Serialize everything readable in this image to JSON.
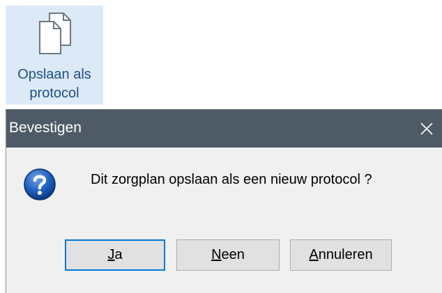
{
  "ribbon": {
    "button": {
      "label_line1": "Opslaan als",
      "label_line2": "protocol",
      "icon": "copy-documents-icon"
    }
  },
  "dialog": {
    "title": "Bevestigen",
    "close_icon": "close-icon",
    "message_icon": "question-icon",
    "message": "Dit zorgplan opslaan als een nieuw protocol ?",
    "buttons": {
      "yes": {
        "accelerator": "J",
        "rest": "a"
      },
      "no": {
        "accelerator": "N",
        "rest": "een"
      },
      "cancel": {
        "accelerator": "A",
        "rest": "nnuleren"
      }
    },
    "colors": {
      "titlebar": "#4e5b66",
      "default_button_border": "#0078d7",
      "ribbon_highlight": "#dce9f7"
    }
  }
}
